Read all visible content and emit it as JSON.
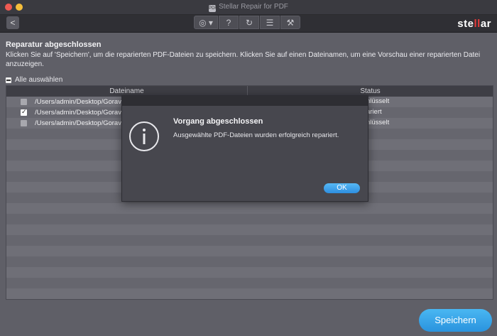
{
  "window": {
    "title": "Stellar Repair for PDF",
    "logo_text": "PDF"
  },
  "toolbar": {
    "back_label": "<",
    "globe_label": "◎ ▾",
    "help_label": "?",
    "refresh_label": "↻",
    "cart_label": "☰",
    "key_label": "⚒"
  },
  "brand": {
    "part1": "ste",
    "part2": "ll",
    "part3": "ar"
  },
  "main": {
    "heading": "Reparatur abgeschlossen",
    "description": "Klicken Sie auf 'Speichern', um die reparierten PDF-Dateien zu speichern. Klicken Sie auf einen Dateinamen, um eine Vorschau einer reparierten Datei anzuzeigen.",
    "select_all_label": "Alle auswählen"
  },
  "table": {
    "columns": [
      "Dateiname",
      "Status"
    ],
    "rows": [
      {
        "path": "/Users/admin/Desktop/Gorav D",
        "status": "nlüsselt",
        "checked": false
      },
      {
        "path": "/Users/admin/Desktop/Gorav D",
        "status": "ariert",
        "checked": true
      },
      {
        "path": "/Users/admin/Desktop/Gorav D",
        "status": "nlüsselt",
        "checked": false
      }
    ]
  },
  "save_button_label": "Speichern",
  "dialog": {
    "title": "Vorgang abgeschlossen",
    "message": "Ausgewählte PDF-Dateien wurden erfolgreich repariert.",
    "ok_label": "OK"
  }
}
